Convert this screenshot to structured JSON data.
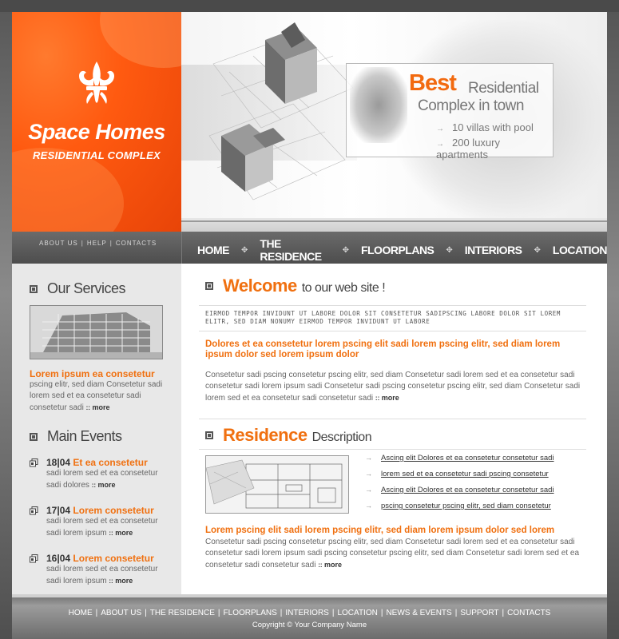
{
  "logo": {
    "title": "Space Homes",
    "subtitle": "RESIDENTIAL COMPLEX",
    "icon": "fleur-de-lis-icon"
  },
  "promo": {
    "best": "Best",
    "residential": "Residential",
    "line2": "Complex in town",
    "items": [
      "10 villas with pool",
      "200 luxury apartments"
    ]
  },
  "small_nav": [
    "ABOUT US",
    "HELP",
    "CONTACTS"
  ],
  "main_nav": [
    "HOME",
    "THE RESIDENCE",
    "FLOORPLANS",
    "INTERIORS",
    "LOCATION"
  ],
  "services": {
    "title": "Our Services",
    "heading": "Lorem ipsum ea consetetur",
    "text": "pscing elitr, sed diam Consetetur sadi lorem sed  et ea consetetur sadi consetetur sadi",
    "more": "more"
  },
  "events": {
    "title": "Main Events",
    "items": [
      {
        "date": "18|04",
        "title": "Et ea consetetur",
        "text": "sadi lorem sed  et ea consetetur sadi dolores",
        "more": "more"
      },
      {
        "date": "17|04",
        "title": "Lorem consetetur",
        "text": "sadi lorem sed  et ea consetetur sadi lorem ipsum",
        "more": "more"
      },
      {
        "date": "16|04",
        "title": "Lorem consetetur",
        "text": "sadi lorem sed  et ea consetetur sadi lorem ipsum",
        "more": "more"
      }
    ]
  },
  "welcome": {
    "big": "Welcome",
    "rest": "to our web site !",
    "mono": "EIRMOD TEMPOR INVIDUNT UT LABORE DOLOR SIT  CONSETETUR SADIPSCING LABORE DOLOR SIT LOREM ELITR, SED DIAM NONUMY EIRMOD TEMPOR INVIDUNT UT LABORE",
    "heading": "Dolores et ea consetetur lorem pscing elit sadi lorem pscing elitr, sed diam lorem ipsum dolor sed lorem ipsum dolor",
    "text": "Consetetur sadi pscing consetetur pscing elitr, sed diam Consetetur sadi lorem sed  et ea consetetur sadi consetetur sadi lorem ipsum sadi Consetetur sadi pscing consetetur pscing elitr, sed diam Consetetur sadi lorem sed  et ea consetetur sadi consetetur sadi",
    "more": "more"
  },
  "residence": {
    "big": "Residence",
    "rest": "Description",
    "links": [
      "Ascing elit Dolores et ea consetetur consetetur sadi",
      "lorem sed  et ea consetetur sadi pscing consetetur ",
      "Ascing elit Dolores et ea consetetur consetetur sadi",
      "pscing consetetur pscing elitr, sed diam consetetur "
    ],
    "heading": "Lorem pscing elit sadi lorem pscing elitr, sed diam lorem ipsum dolor sed lorem",
    "text": "Consetetur sadi pscing consetetur pscing elitr, sed diam Consetetur sadi lorem sed  et ea consetetur sadi consetetur sadi lorem ipsum sadi pscing consetetur pscing elitr, sed diam Consetetur sadi lorem sed  et ea consetetur sadi consetetur sadi",
    "more": "more"
  },
  "footer": {
    "links": [
      "HOME",
      "ABOUT US",
      "THE RESIDENCE",
      "FLOORPLANS",
      "INTERIORS",
      "LOCATION",
      "NEWS & EVENTS",
      "SUPPORT",
      "CONTACTS"
    ],
    "copyright": "Copyright © Your Company Name"
  },
  "colors": {
    "accent": "#f07010",
    "logo_bg": "#ff5a10",
    "nav_bg": "#555555",
    "sidebar_bg": "#e8e8e8"
  }
}
